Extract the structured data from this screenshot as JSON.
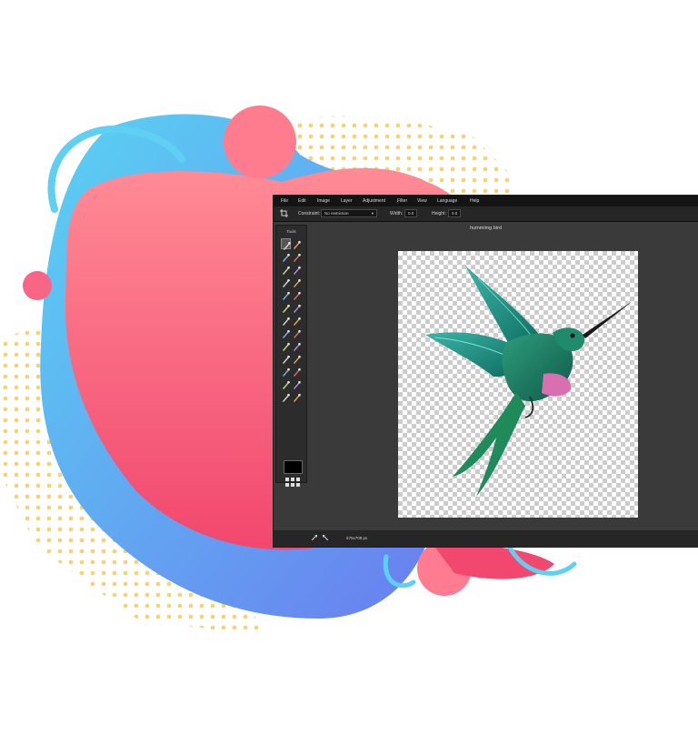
{
  "app": {
    "menu": [
      "File",
      "Edit",
      "Image",
      "Layer",
      "Adjustment",
      "Filter",
      "View",
      "Language",
      "Help"
    ],
    "options": {
      "constraint_label": "Constraint:",
      "constraint_value": "No restriction",
      "width_label": "Width:",
      "width_value": "0.0",
      "height_label": "Height:",
      "height_value": "0.0"
    },
    "tools_title": "Tools",
    "document_title": "hummimg bird",
    "status_text": "675x708 px",
    "primary_color": "#000000",
    "tool_icons": [
      "crop-icon",
      "move-icon",
      "marquee-icon",
      "lasso-icon",
      "magic-wand-icon",
      "pencil-icon",
      "brush-icon",
      "paint-bucket-icon",
      "clone-stamp-icon",
      "eraser-icon",
      "gradient-icon",
      "smudge-icon",
      "sharpen-icon",
      "blur-icon",
      "sponge-icon",
      "dodge-icon",
      "burn-icon",
      "color-replace-icon",
      "red-eye-icon",
      "drawing-icon",
      "text-icon",
      "hand-icon",
      "zoom-icon",
      "eyedropper-icon",
      "shape-icon",
      "heal-icon"
    ]
  }
}
